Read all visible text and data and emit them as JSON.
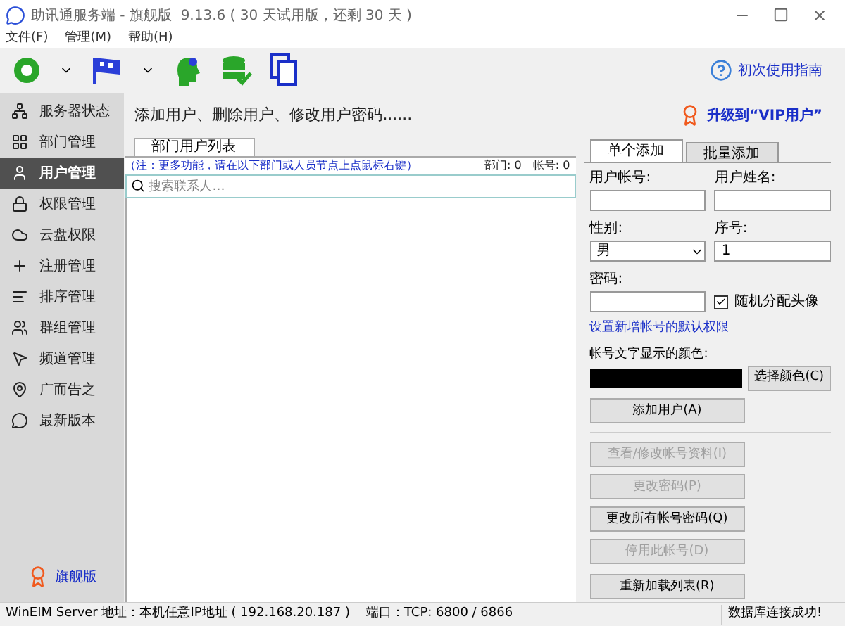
{
  "window": {
    "title": "助讯通服务端 - 旗舰版  9.13.6 ( 30 天试用版，还剩 30 天 )"
  },
  "menu": [
    "文件(F)",
    "管理(M)",
    "帮助(H)"
  ],
  "toolbar": {
    "help_link": "初次使用指南"
  },
  "sidebar": {
    "items": [
      {
        "label": "服务器状态",
        "selected": false
      },
      {
        "label": "部门管理",
        "selected": false
      },
      {
        "label": "用户管理",
        "selected": true
      },
      {
        "label": "权限管理",
        "selected": false
      },
      {
        "label": "云盘权限",
        "selected": false
      },
      {
        "label": "注册管理",
        "selected": false
      },
      {
        "label": "排序管理",
        "selected": false
      },
      {
        "label": "群组管理",
        "selected": false
      },
      {
        "label": "频道管理",
        "selected": false
      },
      {
        "label": "广而告之",
        "selected": false
      },
      {
        "label": "最新版本",
        "selected": false
      }
    ],
    "edition": "旗舰版"
  },
  "header": {
    "title": "添加用户、删除用户、修改用户密码......",
    "upgrade": "升级到“VIP用户”"
  },
  "list_panel": {
    "tab": "部门用户列表",
    "note": "（注：更多功能，请在以下部门或人员节点上点鼠标右键）",
    "dept_count": "部门: 0",
    "account_count": "帐号: 0",
    "search_placeholder": "搜索联系人…"
  },
  "form": {
    "tabs": [
      {
        "label": "单个添加",
        "selected": true
      },
      {
        "label": "批量添加",
        "selected": false
      }
    ],
    "account_label": "用户帐号:",
    "name_label": "用户姓名:",
    "gender_label": "性别:",
    "gender_value": "男",
    "order_label": "序号:",
    "order_value": "1",
    "password_label": "密码:",
    "random_avatar": {
      "label": "随机分配头像",
      "checked": true
    },
    "permission_link": "设置新增帐号的默认权限",
    "color_label": "帐号文字显示的颜色:",
    "color": "#000000",
    "choose_color": "选择颜色(C)",
    "add_button": "添加用户(A)",
    "buttons": [
      {
        "label": "查看/修改帐号资料(I)",
        "disabled": true
      },
      {
        "label": "更改密码(P)",
        "disabled": true
      },
      {
        "label": "更改所有帐号密码(Q)",
        "disabled": false
      },
      {
        "label": "停用此帐号(D)",
        "disabled": true
      }
    ],
    "reload": "重新加载列表(R)"
  },
  "status_bar": {
    "server": "WinEIM Server 地址：本机任意IP地址 ( 192.168.20.187 )    端口：TCP: 6800 / 6866",
    "db": "数据库连接成功!"
  }
}
